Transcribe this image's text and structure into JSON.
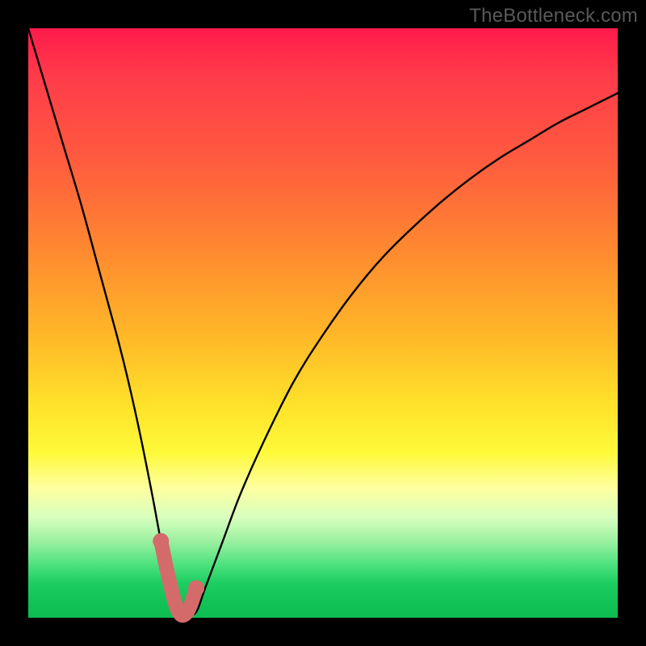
{
  "watermark": "TheBottleneck.com",
  "chart_data": {
    "type": "line",
    "title": "",
    "xlabel": "",
    "ylabel": "",
    "xlim": [
      0,
      100
    ],
    "ylim": [
      0,
      100
    ],
    "series": [
      {
        "name": "bottleneck-curve",
        "x": [
          0,
          3,
          6,
          9,
          12,
          15,
          17,
          19,
          21,
          22.5,
          24,
          25.5,
          27,
          28.5,
          30,
          33,
          36,
          40,
          45,
          50,
          55,
          60,
          65,
          70,
          75,
          80,
          85,
          90,
          95,
          100
        ],
        "values": [
          100,
          90,
          80,
          70,
          59,
          48,
          40,
          31,
          21,
          13,
          6,
          1,
          0.5,
          1,
          5,
          13,
          21,
          30,
          40,
          48,
          55,
          61,
          66,
          70.5,
          74.5,
          78,
          81,
          84,
          86.5,
          89
        ]
      },
      {
        "name": "highlight-band",
        "x": [
          22.5,
          24,
          25.5,
          27,
          28.5
        ],
        "values": [
          13,
          6,
          1,
          1,
          5
        ]
      }
    ],
    "colors": {
      "curve": "#000000",
      "highlight": "#d46a6a",
      "gradient_top": "#ff1a4b",
      "gradient_mid": "#ffe22a",
      "gradient_bottom": "#0ebd51"
    }
  }
}
